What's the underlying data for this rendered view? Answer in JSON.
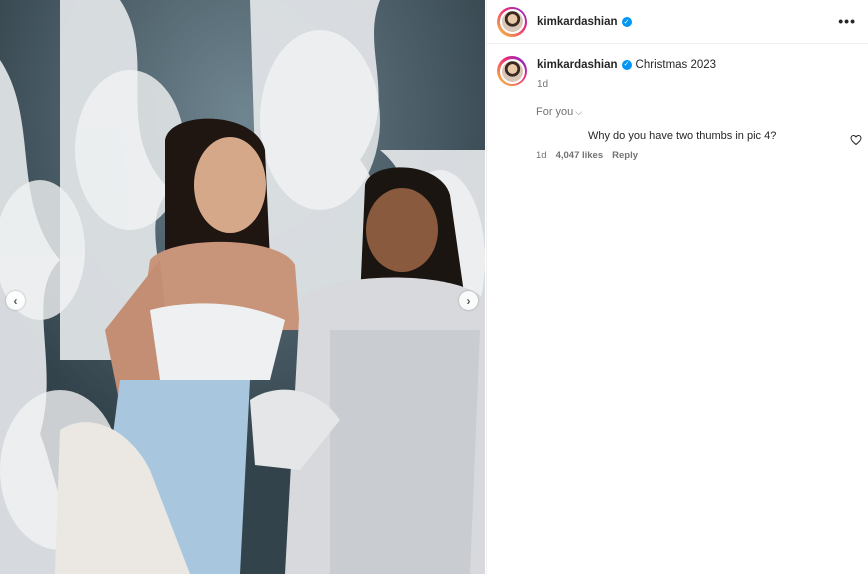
{
  "media": {
    "prev_icon": "chevron-left-icon",
    "next_icon": "chevron-right-icon",
    "prev_glyph": "‹",
    "next_glyph": "›"
  },
  "header": {
    "username": "kimkardashian",
    "verified_glyph": "✓",
    "more_glyph": "•••"
  },
  "caption": {
    "username": "kimkardashian",
    "text": "Christmas 2023",
    "time": "1d"
  },
  "sort": {
    "label": "For you",
    "chevron": "⌵"
  },
  "comment": {
    "text": "Why do you have two thumbs in pic 4?",
    "time": "1d",
    "likes": "4,047 likes",
    "reply": "Reply"
  },
  "colors": {
    "verified": "#0095f6",
    "secondary_text": "#737373"
  }
}
